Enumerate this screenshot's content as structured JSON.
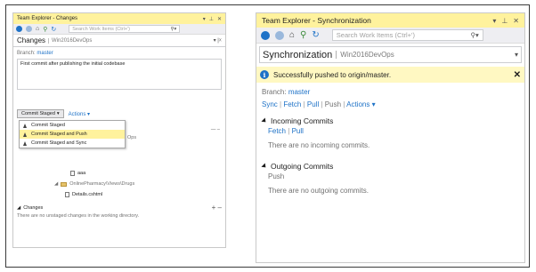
{
  "left": {
    "title": "Team Explorer - Changes",
    "search_placeholder": "Search Work Items (Ctrl+')",
    "header_title": "Changes",
    "header_sub": "Win2016DevOps",
    "branch_label": "Branch:",
    "branch_value": "master",
    "commit_message": "First commit after publishing the initial codebase",
    "commit_button": "Commit Staged",
    "actions_label": "Actions",
    "dropdown_items": [
      {
        "label": "Commit Staged"
      },
      {
        "label": "Commit Staged and Push"
      },
      {
        "label": "Commit Staged and Sync"
      }
    ],
    "staged_partial": "Ops",
    "tree_file_1": "aaa",
    "tree_folder": "OnlinePharmacy\\Views\\Drugs",
    "tree_file_2": "Details.cshtml",
    "changes_title": "Changes",
    "changes_text": "There are no unstaged changes in the working directory."
  },
  "right": {
    "title": "Team Explorer - Synchronization",
    "search_placeholder": "Search Work Items (Ctrl+')",
    "header_title": "Synchronization",
    "header_sub": "Win2016DevOps",
    "info_message": "Successfully pushed to origin/master.",
    "branch_label": "Branch:",
    "branch_value": "master",
    "links": {
      "sync": "Sync",
      "fetch": "Fetch",
      "pull": "Pull",
      "push": "Push",
      "actions": "Actions"
    },
    "incoming": {
      "title": "Incoming Commits",
      "fetch": "Fetch",
      "pull": "Pull",
      "empty": "There are no incoming commits."
    },
    "outgoing": {
      "title": "Outgoing Commits",
      "push": "Push",
      "empty": "There are no outgoing commits."
    }
  },
  "colors": {
    "title_bar": "#fff29d",
    "info_bar": "#fff8c2",
    "link": "#1e72c7",
    "toolbar": "#eeeef2"
  }
}
